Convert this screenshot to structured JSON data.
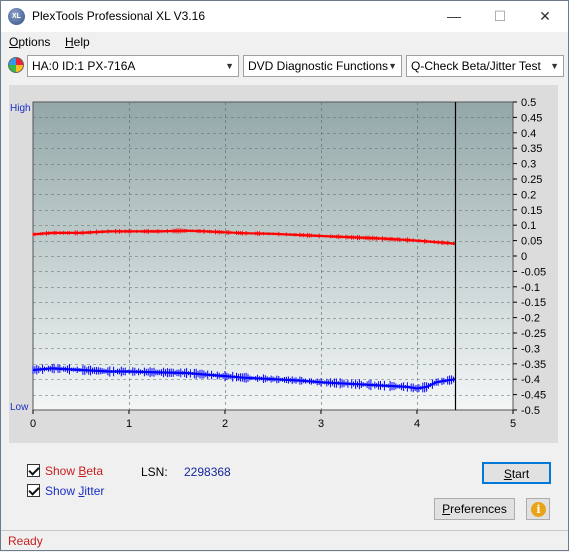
{
  "window": {
    "title": "PlexTools Professional XL V3.16",
    "icon_label": "XL",
    "minimize": "—",
    "maximize": "☐",
    "close": "✕"
  },
  "menu": [
    {
      "label": "Options",
      "accel": "O",
      "rest": "ptions"
    },
    {
      "label": "Help",
      "accel": "H",
      "rest": "elp"
    }
  ],
  "toolbar": {
    "drive_icon": "disc-drive-icon",
    "drive": "HA:0 ID:1  PX-716A",
    "function": "DVD Diagnostic Functions",
    "test": "Q-Check Beta/Jitter Test"
  },
  "chart_labels": {
    "high": "High",
    "low": "Low"
  },
  "chart_data": {
    "type": "line",
    "xlim": [
      0,
      5
    ],
    "ylim": [
      -0.5,
      0.5
    ],
    "x_ticks": [
      "0",
      "1",
      "2",
      "3",
      "4",
      "5"
    ],
    "y_ticks": [
      "0.5",
      "0.45",
      "0.4",
      "0.35",
      "0.3",
      "0.25",
      "0.2",
      "0.15",
      "0.1",
      "0.05",
      "0",
      "-0.05",
      "-0.1",
      "-0.15",
      "-0.2",
      "-0.25",
      "-0.3",
      "-0.35",
      "-0.4",
      "-0.45",
      "-0.5"
    ],
    "grid": true,
    "end_marker_x": 4.4,
    "series": [
      {
        "role": "beta",
        "color": "#ff0000",
        "x": [
          0,
          0.2,
          0.5,
          0.8,
          1.0,
          1.3,
          1.6,
          1.8,
          2.0,
          2.2,
          2.5,
          2.8,
          3.0,
          3.3,
          3.6,
          3.9,
          4.0,
          4.2,
          4.4
        ],
        "y": [
          0.07,
          0.075,
          0.075,
          0.08,
          0.08,
          0.08,
          0.082,
          0.08,
          0.077,
          0.074,
          0.072,
          0.068,
          0.065,
          0.061,
          0.057,
          0.052,
          0.05,
          0.045,
          0.04
        ]
      },
      {
        "role": "jitter",
        "color": "#0000ff",
        "x": [
          0,
          0.2,
          0.5,
          0.8,
          1.0,
          1.3,
          1.6,
          1.8,
          2.0,
          2.2,
          2.5,
          2.8,
          3.0,
          3.3,
          3.6,
          3.9,
          4.0,
          4.1,
          4.2,
          4.3,
          4.4
        ],
        "y": [
          -0.37,
          -0.365,
          -0.37,
          -0.375,
          -0.375,
          -0.378,
          -0.38,
          -0.385,
          -0.39,
          -0.395,
          -0.4,
          -0.405,
          -0.41,
          -0.415,
          -0.42,
          -0.425,
          -0.43,
          -0.425,
          -0.41,
          -0.405,
          -0.4
        ]
      }
    ]
  },
  "controls": {
    "show_beta": {
      "accel": "B",
      "prefix": "Show ",
      "rest": "eta",
      "checked": true
    },
    "show_jitter": {
      "accel": "J",
      "prefix": "Show ",
      "rest": "itter",
      "checked": true
    },
    "lsn_label": "LSN:",
    "lsn_value": "2298368",
    "start": {
      "accel": "S",
      "rest": "tart"
    },
    "preferences": {
      "accel": "P",
      "rest": "references"
    },
    "info_glyph": "i"
  },
  "status": {
    "text": "Ready"
  }
}
